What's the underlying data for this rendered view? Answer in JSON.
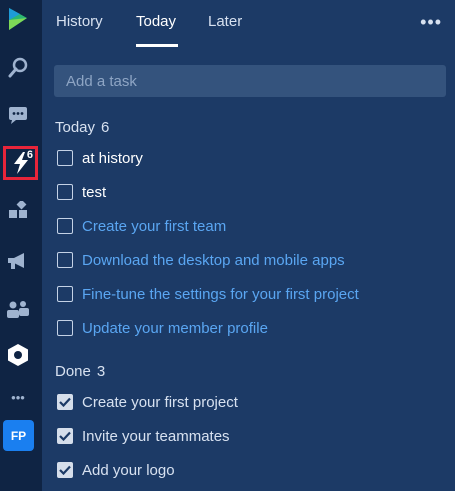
{
  "tabs": [
    {
      "label": "History"
    },
    {
      "label": "Today"
    },
    {
      "label": "Later"
    }
  ],
  "more_label": "•••",
  "add_task": {
    "placeholder": "Add a task",
    "value": ""
  },
  "today": {
    "title": "Today",
    "count": "6",
    "tasks": [
      {
        "label": "at history",
        "style": "plain"
      },
      {
        "label": "test",
        "style": "plain"
      },
      {
        "label": "Create your first team",
        "style": "link"
      },
      {
        "label": "Download the desktop and mobile apps",
        "style": "link"
      },
      {
        "label": "Fine-tune the settings for your first project",
        "style": "link"
      },
      {
        "label": "Update your member profile",
        "style": "link"
      }
    ]
  },
  "done": {
    "title": "Done",
    "count": "3",
    "tasks": [
      {
        "label": "Create your first project"
      },
      {
        "label": "Invite your teammates"
      },
      {
        "label": "Add your logo"
      }
    ]
  },
  "rail": {
    "badge": "6",
    "avatar_initials": "FP",
    "more": "•••",
    "icons": [
      "logo-icon",
      "search-icon",
      "chat-icon",
      "lightning-icon",
      "apps-icon",
      "megaphone-icon",
      "people-icon",
      "hexagon-icon",
      "more-icon"
    ]
  },
  "colors": {
    "rail_bg": "#0f2444",
    "panel_bg": "#1c3a66",
    "link": "#5aa6f2",
    "active_outline": "#e8253a",
    "avatar_bg": "#1a7ff0"
  }
}
